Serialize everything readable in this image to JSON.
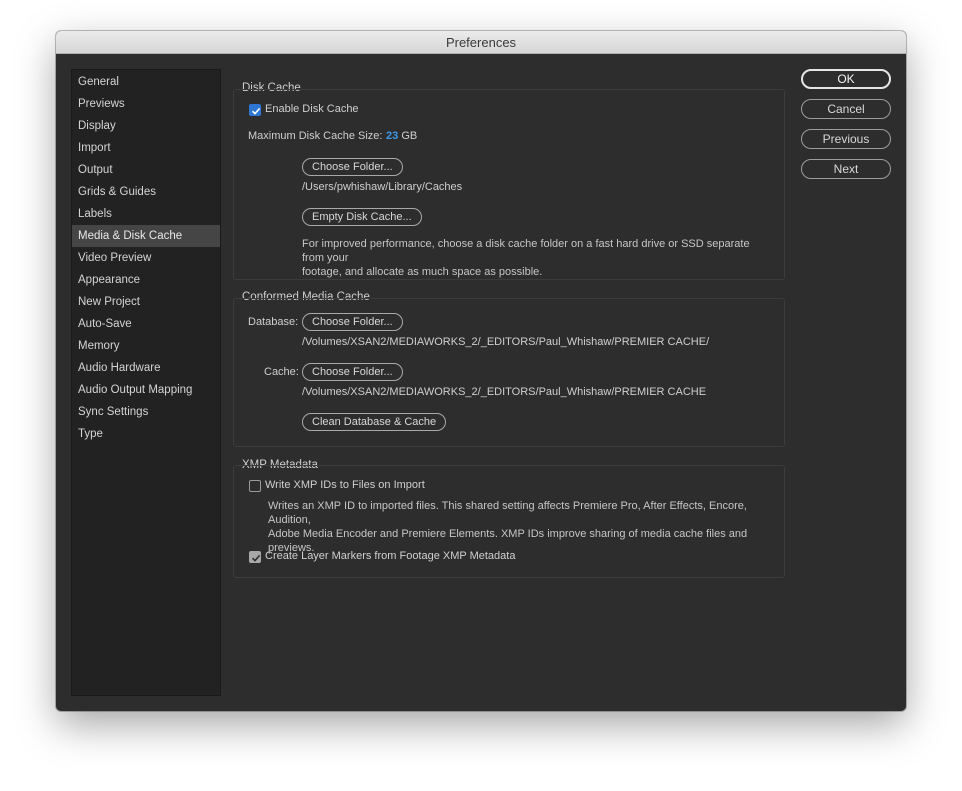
{
  "window": {
    "title": "Preferences"
  },
  "sidebar": {
    "items": [
      {
        "label": "General"
      },
      {
        "label": "Previews"
      },
      {
        "label": "Display"
      },
      {
        "label": "Import"
      },
      {
        "label": "Output"
      },
      {
        "label": "Grids & Guides"
      },
      {
        "label": "Labels"
      },
      {
        "label": "Media & Disk Cache",
        "selected": true
      },
      {
        "label": "Video Preview"
      },
      {
        "label": "Appearance"
      },
      {
        "label": "New Project"
      },
      {
        "label": "Auto-Save"
      },
      {
        "label": "Memory"
      },
      {
        "label": "Audio Hardware"
      },
      {
        "label": "Audio Output Mapping"
      },
      {
        "label": "Sync Settings"
      },
      {
        "label": "Type"
      }
    ]
  },
  "disk_cache": {
    "title": "Disk Cache",
    "enable_label": "Enable Disk Cache",
    "enable_checked": true,
    "max_size_label": "Maximum Disk Cache Size:",
    "max_size_value": "23",
    "max_size_unit": "GB",
    "choose_folder_button": "Choose Folder...",
    "path": "/Users/pwhishaw/Library/Caches",
    "empty_button": "Empty Disk Cache...",
    "note_line1": "For improved performance, choose a disk cache folder on a fast hard drive or SSD separate from your",
    "note_line2": "footage, and allocate as much space as possible."
  },
  "conformed": {
    "title": "Conformed Media Cache",
    "database_label": "Database:",
    "database_button": "Choose Folder...",
    "database_path": "/Volumes/XSAN2/MEDIAWORKS_2/_EDITORS/Paul_Whishaw/PREMIER CACHE/",
    "cache_label": "Cache:",
    "cache_button": "Choose Folder...",
    "cache_path": "/Volumes/XSAN2/MEDIAWORKS_2/_EDITORS/Paul_Whishaw/PREMIER CACHE",
    "clean_button": "Clean Database & Cache"
  },
  "xmp": {
    "title": "XMP Metadata",
    "write_ids_label": "Write XMP IDs to Files on Import",
    "write_ids_checked": false,
    "note_line1": "Writes an XMP ID to imported files. This shared setting affects Premiere Pro, After Effects, Encore, Audition,",
    "note_line2": "Adobe Media Encoder and Premiere Elements. XMP IDs improve sharing of media cache files and previews.",
    "layer_markers_label": "Create Layer Markers from Footage XMP Metadata",
    "layer_markers_checked": true
  },
  "actions": {
    "ok": "OK",
    "cancel": "Cancel",
    "previous": "Previous",
    "next": "Next"
  },
  "colors": {
    "accent": "#2f76d2",
    "value_link": "#3d9ae8",
    "panel_bg": "#2d2d2d",
    "sidebar_bg": "#222222",
    "selected_bg": "#454545"
  }
}
